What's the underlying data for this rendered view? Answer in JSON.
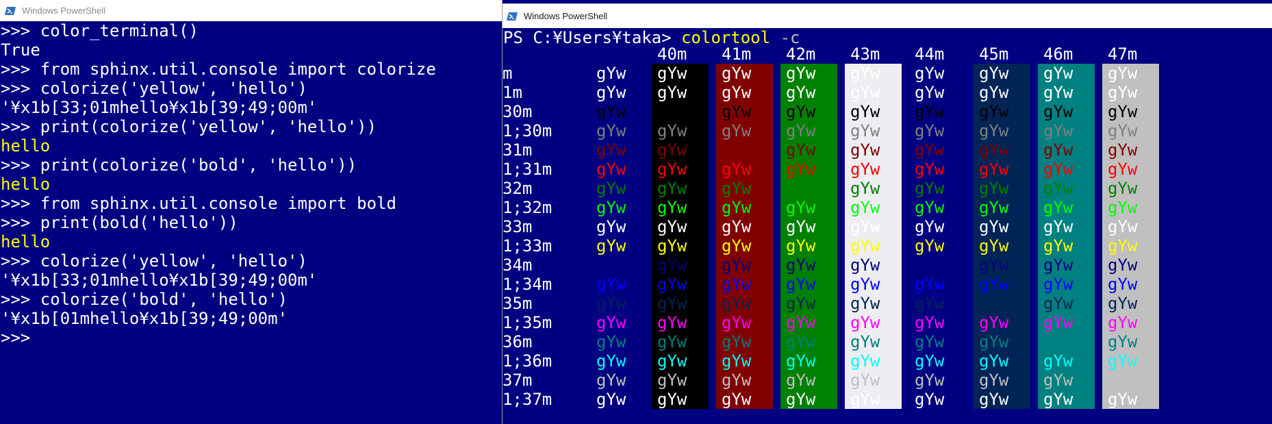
{
  "left_window": {
    "title": "Windows PowerShell",
    "lines": [
      {
        "text": ">>> color_terminal()",
        "color": "white"
      },
      {
        "text": "True",
        "color": "white"
      },
      {
        "text": ">>> from sphinx.util.console import colorize",
        "color": "white"
      },
      {
        "text": ">>> colorize('yellow', 'hello')",
        "color": "white"
      },
      {
        "text": "'¥x1b[33;01mhello¥x1b[39;49;00m'",
        "color": "white"
      },
      {
        "text": ">>> print(colorize('yellow', 'hello'))",
        "color": "white"
      },
      {
        "text": "hello",
        "color": "yellow"
      },
      {
        "text": ">>> print(colorize('bold', 'hello'))",
        "color": "white"
      },
      {
        "text": "hello",
        "color": "yellow"
      },
      {
        "text": ">>> from sphinx.util.console import bold",
        "color": "white"
      },
      {
        "text": ">>> print(bold('hello'))",
        "color": "white"
      },
      {
        "text": "hello",
        "color": "yellow"
      },
      {
        "text": ">>> colorize('yellow', 'hello')",
        "color": "white"
      },
      {
        "text": "'¥x1b[33;01mhello¥x1b[39;49;00m'",
        "color": "white"
      },
      {
        "text": ">>> colorize('bold', 'hello')",
        "color": "white"
      },
      {
        "text": "'¥x1b[01mhello¥x1b[39;49;00m'",
        "color": "white"
      },
      {
        "text": ">>>",
        "color": "white"
      }
    ]
  },
  "right_window": {
    "title": "Windows PowerShell",
    "prompt": "PS C:¥Users¥taka>",
    "command": "colortool",
    "flag": "-c",
    "sample_text": "gYw",
    "columns": [
      {
        "label": "",
        "bg": "#000080"
      },
      {
        "label": "40m",
        "bg": "#000000"
      },
      {
        "label": "41m",
        "bg": "#800000"
      },
      {
        "label": "42m",
        "bg": "#008000"
      },
      {
        "label": "43m",
        "bg": "#eeeef2"
      },
      {
        "label": "44m",
        "bg": "#000080"
      },
      {
        "label": "45m",
        "bg": "#012456"
      },
      {
        "label": "46m",
        "bg": "#008080"
      },
      {
        "label": "47m",
        "bg": "#c0c0c0"
      }
    ],
    "rows": [
      {
        "label": "m",
        "fg": "#ffffff"
      },
      {
        "label": "1m",
        "fg": "#ffffff"
      },
      {
        "label": "30m",
        "fg": "#000000"
      },
      {
        "label": "1;30m",
        "fg": "#808080"
      },
      {
        "label": "31m",
        "fg": "#800000"
      },
      {
        "label": "1;31m",
        "fg": "#ff0000"
      },
      {
        "label": "32m",
        "fg": "#008000"
      },
      {
        "label": "1;32m",
        "fg": "#00ff00"
      },
      {
        "label": "33m",
        "fg": "#ffffff"
      },
      {
        "label": "1;33m",
        "fg": "#ffff00"
      },
      {
        "label": "34m",
        "fg": "#000080"
      },
      {
        "label": "1;34m",
        "fg": "#0000ff"
      },
      {
        "label": "35m",
        "fg": "#012456"
      },
      {
        "label": "1;35m",
        "fg": "#ff00ff"
      },
      {
        "label": "36m",
        "fg": "#008080"
      },
      {
        "label": "1;36m",
        "fg": "#00ffff"
      },
      {
        "label": "37m",
        "fg": "#c0c0c0"
      },
      {
        "label": "1;37m",
        "fg": "#ffffff"
      }
    ],
    "colors": {
      "prompt_fg": "#ffffff",
      "command_fg": "#ffff00",
      "flag_fg": "#c0c0c0"
    }
  }
}
